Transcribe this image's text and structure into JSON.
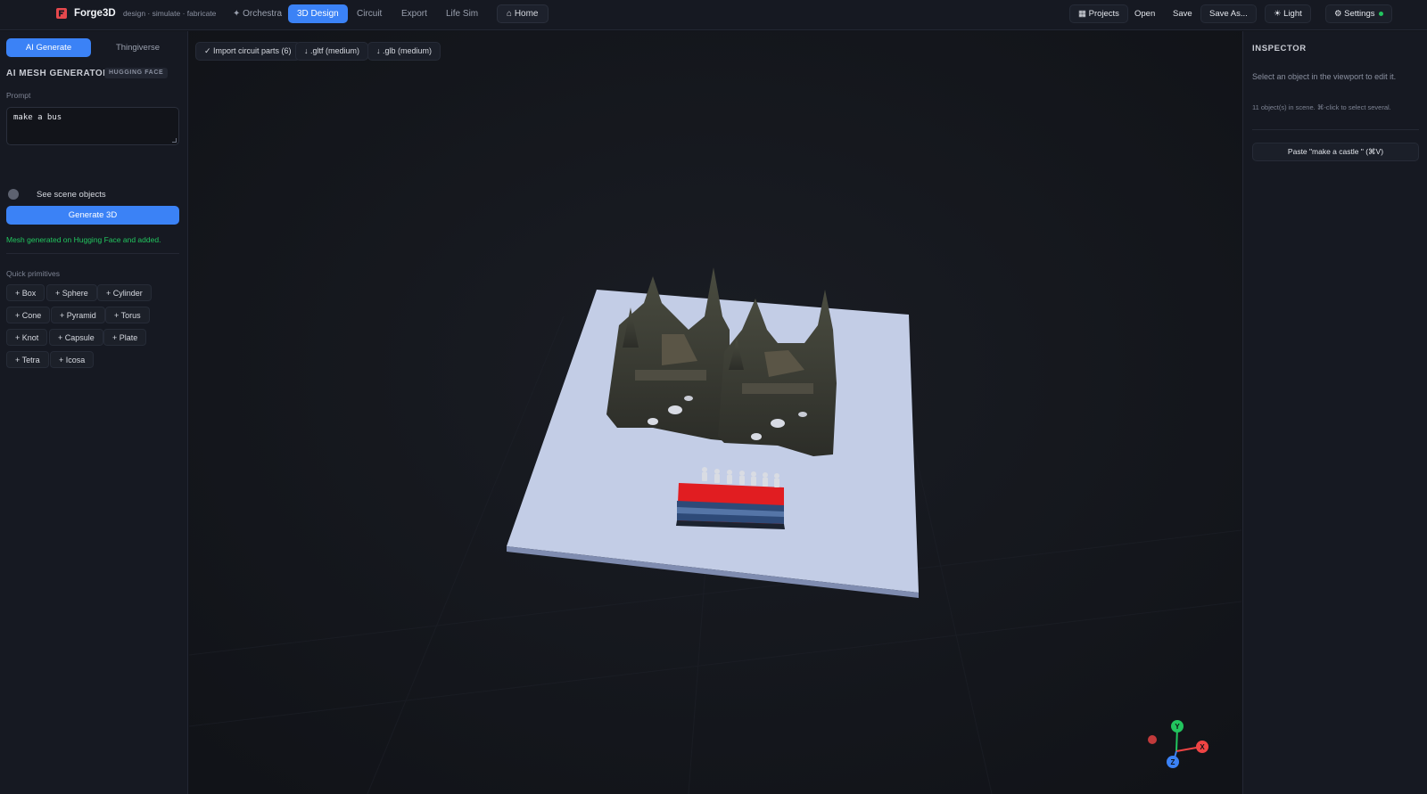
{
  "header": {
    "brand": "Forge3D",
    "tagline": "design · simulate · fabricate",
    "nav": [
      {
        "label": "✦ Orchestra",
        "active": false
      },
      {
        "label": "3D Design",
        "active": true
      },
      {
        "label": "Circuit",
        "active": false
      },
      {
        "label": "Export",
        "active": false
      },
      {
        "label": "Life Sim",
        "active": false
      }
    ],
    "home_label": "⌂ Home",
    "projects_label": "▦ Projects",
    "open_label": "Open",
    "save_label": "Save",
    "save_as_label": "Save As...",
    "theme_label": "☀ Light",
    "settings_label": "⚙ Settings"
  },
  "sidebar": {
    "tabs": [
      {
        "label": "AI Generate",
        "active": true
      },
      {
        "label": "Thingiverse",
        "active": false
      }
    ],
    "section_title": "AI MESH GENERATOR",
    "badge": "HUGGING FACE",
    "prompt_label": "Prompt",
    "prompt_value": "make a bus",
    "toggle_label": "See scene objects",
    "toggle_on": false,
    "generate_label": "Generate 3D",
    "status_message": "Mesh generated on Hugging Face and added.",
    "primitives_label": "Quick primitives",
    "primitives": [
      "+ Box",
      "+ Sphere",
      "+ Cylinder",
      "+ Cone",
      "+ Pyramid",
      "+ Torus",
      "+ Knot",
      "+ Capsule",
      "+ Plate",
      "+ Tetra",
      "+ Icosa"
    ]
  },
  "viewport": {
    "toolbar": [
      "✓ Import circuit parts (6)",
      "↓ .gltf (medium)",
      "↓ .glb (medium)"
    ],
    "axes": {
      "x": "X",
      "y": "Y",
      "z": "Z"
    },
    "colors": {
      "x_axis": "#ef4444",
      "y_axis": "#22c55e",
      "z_axis": "#3b82f6",
      "plate": "#c3cde6",
      "bus": "#e11d21"
    }
  },
  "inspector": {
    "title": "INSPECTOR",
    "hint": "Select an object in the viewport to edit it.",
    "count_text": "11 object(s) in scene. ⌘-click to select several.",
    "paste_label": "Paste \"make a castle \" (⌘V)"
  },
  "colors": {
    "accent": "#3b82f6",
    "success": "#22c55e"
  }
}
